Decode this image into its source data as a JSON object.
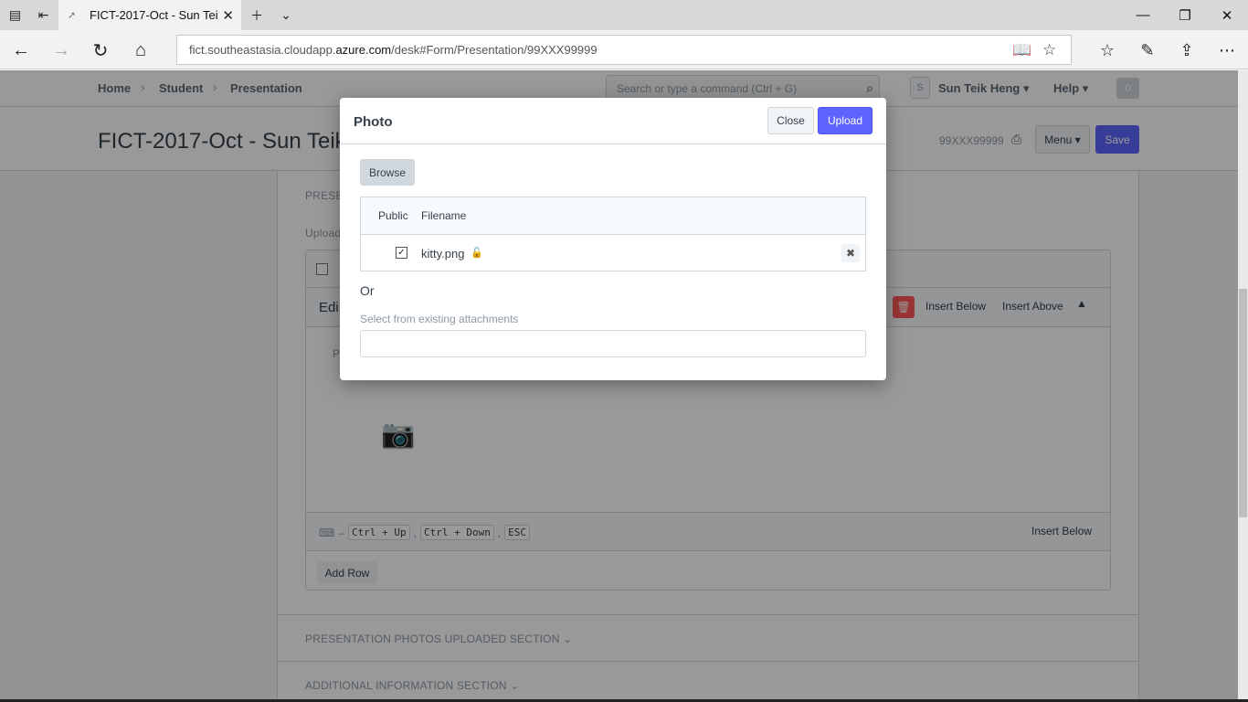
{
  "browser": {
    "tab_title": "FICT-2017-Oct - Sun Tei",
    "url_prefix": "fict.southeastasia.cloudapp.",
    "url_domain": "azure.com",
    "url_path": "/desk#Form/Presentation/99XXX99999"
  },
  "navbar": {
    "breadcrumbs": [
      "Home",
      "Student",
      "Presentation"
    ],
    "search_placeholder": "Search or type a command (Ctrl + G)",
    "avatar_letter": "S",
    "user_name": "Sun Teik Heng",
    "help_label": "Help",
    "notification_count": "0"
  },
  "page": {
    "title": "FICT-2017-Oct - Sun Teik",
    "doc_id": "99XXX99999",
    "menu_label": "Menu",
    "save_label": "Save"
  },
  "form": {
    "section_label": "PRESEN",
    "upload_label": "Upload",
    "edit_row_label": "Edi",
    "photo_field_label": "P",
    "insert_below_label": "Insert Below",
    "insert_above_label": "Insert Above",
    "shortcut_keys": [
      "Ctrl + Up",
      "Ctrl + Down",
      "ESC"
    ],
    "footer_insert_below": "Insert Below",
    "add_row_label": "Add Row",
    "sections": [
      "PRESENTATION PHOTOS UPLOADED SECTION",
      "ADDITIONAL INFORMATION SECTION"
    ]
  },
  "modal": {
    "title": "Photo",
    "close_label": "Close",
    "upload_label": "Upload",
    "browse_label": "Browse",
    "columns": [
      "Public",
      "Filename"
    ],
    "files": [
      {
        "public": true,
        "filename": "kitty.png"
      }
    ],
    "or_text": "Or",
    "existing_label": "Select from existing attachments",
    "existing_value": ""
  },
  "colors": {
    "primary": "#5e64ff",
    "danger": "#ff5858",
    "lock": "#ffa00a"
  }
}
